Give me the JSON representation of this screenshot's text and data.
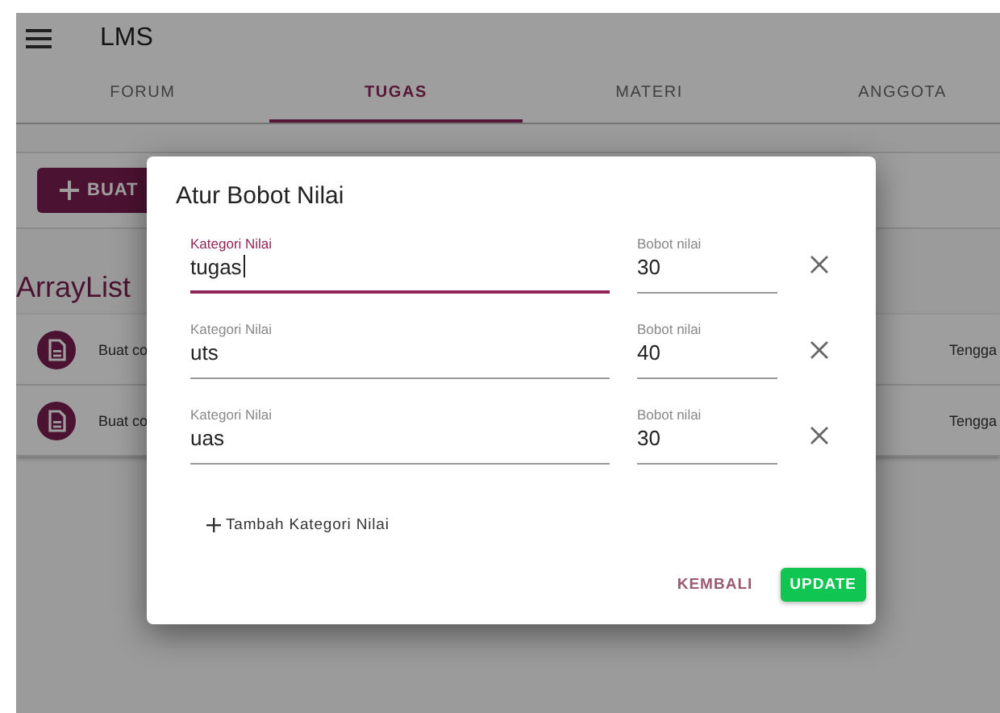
{
  "app_bar": {
    "title": "LMS"
  },
  "tabs": [
    {
      "label": "FORUM",
      "selected": false
    },
    {
      "label": "TUGAS",
      "selected": true
    },
    {
      "label": "MATERI",
      "selected": false
    },
    {
      "label": "ANGGOTA",
      "selected": false
    }
  ],
  "create_button": {
    "label": "BUAT"
  },
  "section_title": "ArrayList",
  "list": [
    {
      "title": "Buat co",
      "trailing": "Tengga"
    },
    {
      "title": "Buat co",
      "trailing": "Tengga"
    }
  ],
  "dialog": {
    "title": "Atur Bobot Nilai",
    "rows": [
      {
        "category_label": "Kategori Nilai",
        "category": "tugas",
        "weight_label": "Bobot nilai",
        "weight": "30",
        "focused": true
      },
      {
        "category_label": "Kategori Nilai",
        "category": "uts",
        "weight_label": "Bobot nilai",
        "weight": "40",
        "focused": false
      },
      {
        "category_label": "Kategori Nilai",
        "category": "uas",
        "weight_label": "Bobot nilai",
        "weight": "30",
        "focused": false
      }
    ],
    "add_button": "Tambah Kategori Nilai",
    "actions": [
      {
        "label": "KEMBALI",
        "kind": "text"
      },
      {
        "label": "UPDATE",
        "kind": "primary"
      }
    ]
  }
}
